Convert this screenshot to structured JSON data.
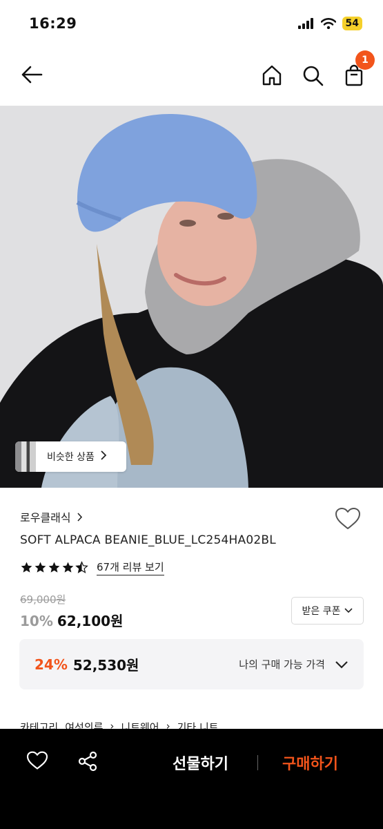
{
  "status_bar": {
    "time": "16:29",
    "battery": "54"
  },
  "header": {
    "cart_count": "1"
  },
  "hero": {
    "similar_label": "비슷한 상품"
  },
  "product": {
    "brand": "로우클래식",
    "name": "SOFT ALPACA BEANIE_BLUE_LC254HA02BL",
    "rating": 4.5,
    "review_link": "67개 리뷰 보기",
    "original_price": "69,000원",
    "discount_rate": "10%",
    "price": "62,100원",
    "coupon_label": "받은 쿠폰"
  },
  "my_price": {
    "rate": "24%",
    "price": "52,530원",
    "label": "나의 구매 가능 가격"
  },
  "category": {
    "label": "카테고리",
    "path": [
      "여성의류",
      "니트웨어",
      "기타 니트"
    ]
  },
  "bottom_bar": {
    "gift_label": "선물하기",
    "buy_label": "구매하기"
  },
  "colors": {
    "accent": "#f2541b",
    "bottom_bar": "#000000"
  },
  "icons": [
    "back-arrow-icon",
    "home-icon",
    "search-icon",
    "cart-icon",
    "heart-icon",
    "share-icon",
    "chevron-right-icon",
    "chevron-down-icon"
  ]
}
